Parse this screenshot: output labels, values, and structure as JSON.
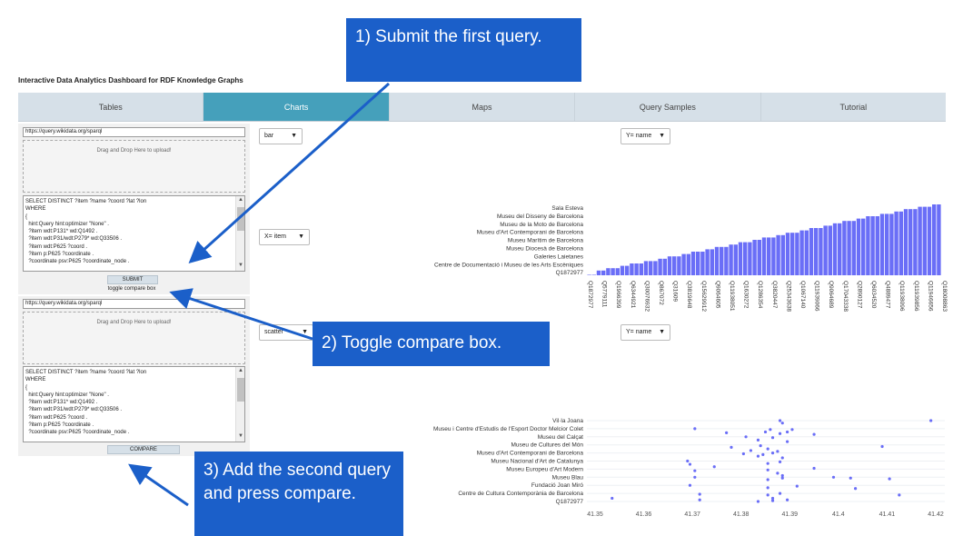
{
  "app": {
    "title": "Interactive Data Analytics Dashboard for RDF Knowledge Graphs"
  },
  "tabs": [
    {
      "label": "Tables"
    },
    {
      "label": "Charts"
    },
    {
      "label": "Maps"
    },
    {
      "label": "Query Samples"
    },
    {
      "label": "Tutorial"
    }
  ],
  "active_tab": "Charts",
  "query_panel_1": {
    "endpoint": "https://query.wikidata.org/sparql",
    "dropzone": "Drag and Drop Here to upload!",
    "query_lines": [
      "SELECT DISTINCT ?item ?name ?coord ?lat ?lon",
      "WHERE",
      "{",
      "  hint:Query hint:optimizer \"None\" .",
      "  ?item wdt:P131* wd:Q1492 .",
      "  ?item wdt:P31/wdt:P279* wd:Q33506 .",
      "  ?item wdt:P625 ?coord .",
      "  ?item p:P625 ?coordinate .",
      "  ?coordinate psv:P625 ?coordinate_node ."
    ],
    "submit_label": "SUBMIT",
    "toggle_label": "toggle compare box"
  },
  "query_panel_2": {
    "endpoint": "https://query.wikidata.org/sparql",
    "dropzone": "Drag and Drop Here to upload!",
    "query_lines": [
      "SELECT DISTINCT ?item ?name ?coord ?lat ?lon",
      "WHERE",
      "{",
      "  hint:Query hint:optimizer \"None\" .",
      "  ?item wdt:P131* wd:Q1492 .",
      "  ?item wdt:P31/wdt:P279* wd:Q33506 .",
      "  ?item wdt:P625 ?coord .",
      "  ?item p:P625 ?coordinate .",
      "  ?coordinate psv:P625 ?coordinate_node ."
    ],
    "compare_label": "COMPARE"
  },
  "controls": {
    "chart_type_1": "bar",
    "x_select_1": "X= item",
    "y_select_1": "Y= name",
    "chart_type_2": "scatter",
    "y_select_2": "Y= name"
  },
  "callouts": {
    "step1": "1) Submit the first query.",
    "step2": "2) Toggle compare box.",
    "step3": "3) Add the second query and press compare."
  },
  "colors": {
    "bar": "#6a6ef7",
    "tab_active": "#45a0bb",
    "tab_bg": "#d6e0e8",
    "callout": "#1b5fc9"
  },
  "chart_data": [
    {
      "type": "bar",
      "y_labels": [
        "Sala Esteva",
        "Museu del Disseny de Barcelona",
        "Museu de la Moto de Barcelona",
        "Museu d'Art Contemporani de Barcelona",
        "Museu Marítim de Barcelona",
        "Museu Diocesà de Barcelona",
        "Galeries Laietanes",
        "Centre de Documentació i Museu de les Arts Escèniques",
        "Q1872977"
      ],
      "x_labels": [
        "Q1872977",
        "Q5779111",
        "Q1966399",
        "Q6344921",
        "Q30076932",
        "Q867072",
        "Q31609",
        "Q3819648",
        "Q15629912",
        "Q9064605",
        "Q11938051",
        "Q1630272",
        "Q1286354",
        "Q3820447",
        "Q25343638",
        "Q1067140",
        "Q11939066",
        "Q9064689",
        "Q17043338",
        "Q2890127",
        "Q6034520",
        "Q4889477",
        "Q11938096",
        "Q11939856",
        "Q11946656",
        "Q18008863"
      ],
      "values": [
        0.2,
        0.2,
        2,
        2,
        3,
        3,
        3,
        4,
        4,
        5,
        5,
        5,
        6,
        6,
        6,
        7,
        7,
        8,
        8,
        8,
        9,
        9,
        10,
        10,
        10,
        11,
        11,
        12,
        12,
        12,
        13,
        13,
        14,
        14,
        14,
        15,
        15,
        16,
        16,
        16,
        17,
        17,
        18,
        18,
        18,
        19,
        19,
        20,
        20,
        20,
        21,
        21,
        22,
        22,
        23,
        23,
        23,
        24,
        24,
        25,
        25,
        25,
        26,
        26,
        26,
        27,
        27,
        28,
        28,
        28,
        29,
        29,
        29,
        30,
        30
      ]
    },
    {
      "type": "scatter",
      "y_labels": [
        "Vil·la Joana",
        "Museu i Centre d'Estudis de l'Esport Doctor Melcior Colet",
        "Museu del Calçat",
        "Museu de Cultures del Món",
        "Museu d'Art Contemporani de Barcelona",
        "Museu Nacional d'Art de Catalunya",
        "Museu Europeu d'Art Modern",
        "Museu Blau",
        "Fundació Joan Miró",
        "Centre de Cultura Contemporània de Barcelona",
        "Q1872977"
      ],
      "x_ticks": [
        "41.35",
        "41.36",
        "41.37",
        "41.38",
        "41.39",
        "41.4",
        "41.41",
        "41.42"
      ],
      "xlim": [
        41.35,
        41.42
      ],
      "points": [
        {
          "x": 41.419,
          "y": 0
        },
        {
          "x": 41.388,
          "y": 0
        },
        {
          "x": 41.3885,
          "y": 0.3
        },
        {
          "x": 41.3705,
          "y": 1
        },
        {
          "x": 41.377,
          "y": 1.5
        },
        {
          "x": 41.385,
          "y": 1.4
        },
        {
          "x": 41.386,
          "y": 1.1
        },
        {
          "x": 41.388,
          "y": 1.6
        },
        {
          "x": 41.3905,
          "y": 1.1
        },
        {
          "x": 41.3895,
          "y": 1.4
        },
        {
          "x": 41.381,
          "y": 2
        },
        {
          "x": 41.3835,
          "y": 2.4
        },
        {
          "x": 41.3865,
          "y": 2.1
        },
        {
          "x": 41.3895,
          "y": 2.6
        },
        {
          "x": 41.395,
          "y": 1.7
        },
        {
          "x": 41.378,
          "y": 3.3
        },
        {
          "x": 41.382,
          "y": 3.7
        },
        {
          "x": 41.384,
          "y": 3.1
        },
        {
          "x": 41.3855,
          "y": 3.5
        },
        {
          "x": 41.3875,
          "y": 3.8
        },
        {
          "x": 41.409,
          "y": 3.2
        },
        {
          "x": 41.3805,
          "y": 4.1
        },
        {
          "x": 41.3835,
          "y": 4.4
        },
        {
          "x": 41.3845,
          "y": 4.2
        },
        {
          "x": 41.3865,
          "y": 4
        },
        {
          "x": 41.3885,
          "y": 4.6
        },
        {
          "x": 41.369,
          "y": 5
        },
        {
          "x": 41.3695,
          "y": 5.4
        },
        {
          "x": 41.3745,
          "y": 5.7
        },
        {
          "x": 41.3855,
          "y": 5.3
        },
        {
          "x": 41.388,
          "y": 5.1
        },
        {
          "x": 41.395,
          "y": 5.9
        },
        {
          "x": 41.3705,
          "y": 6.2
        },
        {
          "x": 41.3855,
          "y": 6.1
        },
        {
          "x": 41.3875,
          "y": 6.5
        },
        {
          "x": 41.3885,
          "y": 6.8
        },
        {
          "x": 41.3705,
          "y": 7
        },
        {
          "x": 41.3855,
          "y": 7.3
        },
        {
          "x": 41.3885,
          "y": 7.1
        },
        {
          "x": 41.399,
          "y": 7
        },
        {
          "x": 41.4025,
          "y": 7.1
        },
        {
          "x": 41.4105,
          "y": 7.2
        },
        {
          "x": 41.3695,
          "y": 8
        },
        {
          "x": 41.3855,
          "y": 8.3
        },
        {
          "x": 41.3915,
          "y": 8.1
        },
        {
          "x": 41.4035,
          "y": 8.4
        },
        {
          "x": 41.3715,
          "y": 9.1
        },
        {
          "x": 41.3855,
          "y": 9.2
        },
        {
          "x": 41.3865,
          "y": 9.6
        },
        {
          "x": 41.388,
          "y": 9
        },
        {
          "x": 41.4125,
          "y": 9.2
        },
        {
          "x": 41.3535,
          "y": 9.6
        },
        {
          "x": 41.3715,
          "y": 9.8
        },
        {
          "x": 41.3835,
          "y": 10
        },
        {
          "x": 41.3865,
          "y": 9.9
        },
        {
          "x": 41.3895,
          "y": 9.8
        }
      ]
    }
  ]
}
